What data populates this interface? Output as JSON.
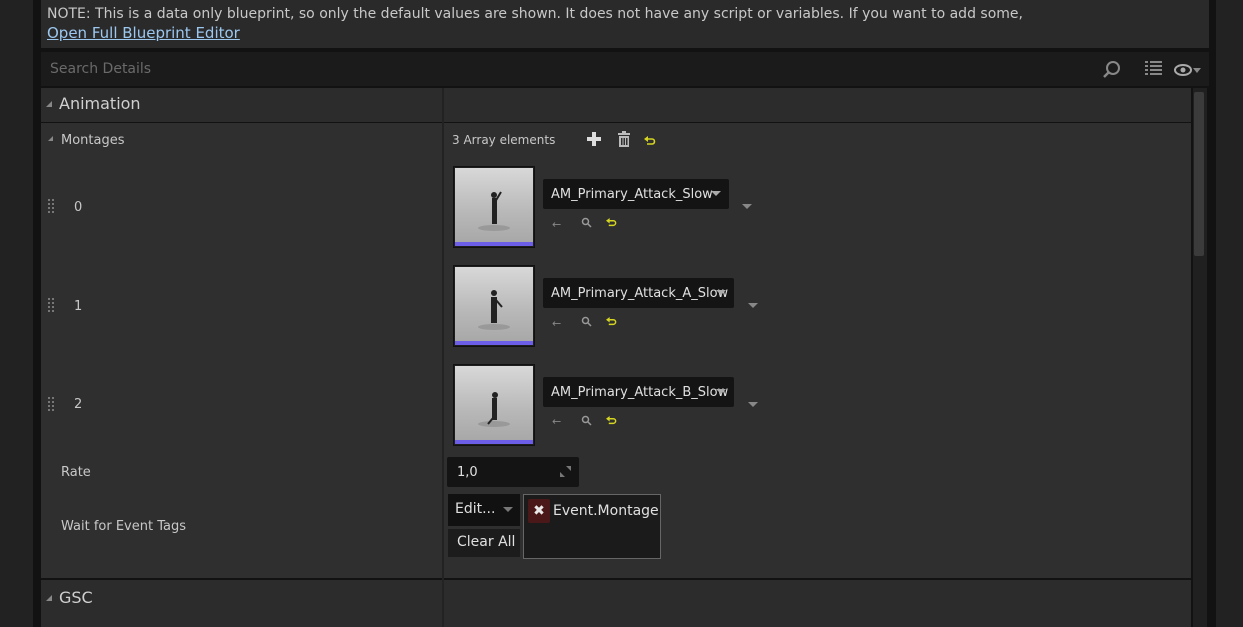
{
  "note": {
    "text": "NOTE: This is a data only blueprint, so only the default values are shown.  It does not have any script or variables.  If you want to add some,",
    "link": "Open Full Blueprint Editor"
  },
  "search": {
    "placeholder": "Search Details"
  },
  "categories": {
    "animation": "Animation",
    "gsc": "GSC"
  },
  "montages": {
    "label": "Montages",
    "count_text": "3 Array elements",
    "items": [
      {
        "index": "0",
        "value": "AM_Primary_Attack_Slow"
      },
      {
        "index": "1",
        "value": "AM_Primary_Attack_A_Slow"
      },
      {
        "index": "2",
        "value": "AM_Primary_Attack_B_Slow"
      }
    ]
  },
  "rate": {
    "label": "Rate",
    "value": "1,0"
  },
  "wait_tags": {
    "label": "Wait for Event Tags",
    "edit_label": "Edit...",
    "clear_label": "Clear All",
    "tags": [
      "Event.Montage"
    ]
  },
  "colors": {
    "thumbnail_bar": "#6d5ee8",
    "link": "#9cc8f0",
    "reset_arrow": "#d6d621",
    "tag_remove_bg": "#4a1818"
  },
  "icons": [
    "search-icon",
    "column-view-icon",
    "eye-icon",
    "plus-icon",
    "trash-icon",
    "reset-arrow-icon",
    "browse-arrow-icon",
    "find-icon",
    "grip-icon",
    "expand-icon",
    "remove-tag-icon"
  ]
}
